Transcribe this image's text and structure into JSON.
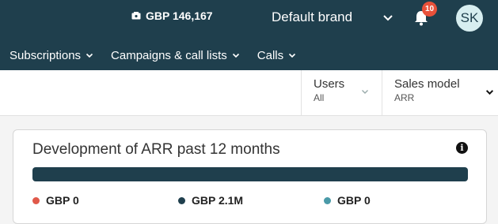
{
  "topbar": {
    "balance": "GBP 146,167",
    "brand": "Default brand",
    "notifications_count": "10",
    "avatar_initials": "SK"
  },
  "nav": {
    "items": [
      {
        "label": "Subscriptions"
      },
      {
        "label": "Campaigns & call lists"
      },
      {
        "label": "Calls"
      }
    ]
  },
  "filters": {
    "users": {
      "label": "Users",
      "value": "All"
    },
    "sales_model": {
      "label": "Sales model",
      "value": "ARR"
    }
  },
  "card": {
    "title": "Development of ARR past 12 months",
    "progress_fraction": 1.0,
    "legend": [
      {
        "label": "GBP 0",
        "color": "#e0594a"
      },
      {
        "label": "GBP 2.1M",
        "color": "#1f3f4d"
      },
      {
        "label": "GBP 0",
        "color": "#4a9aa8"
      }
    ]
  }
}
